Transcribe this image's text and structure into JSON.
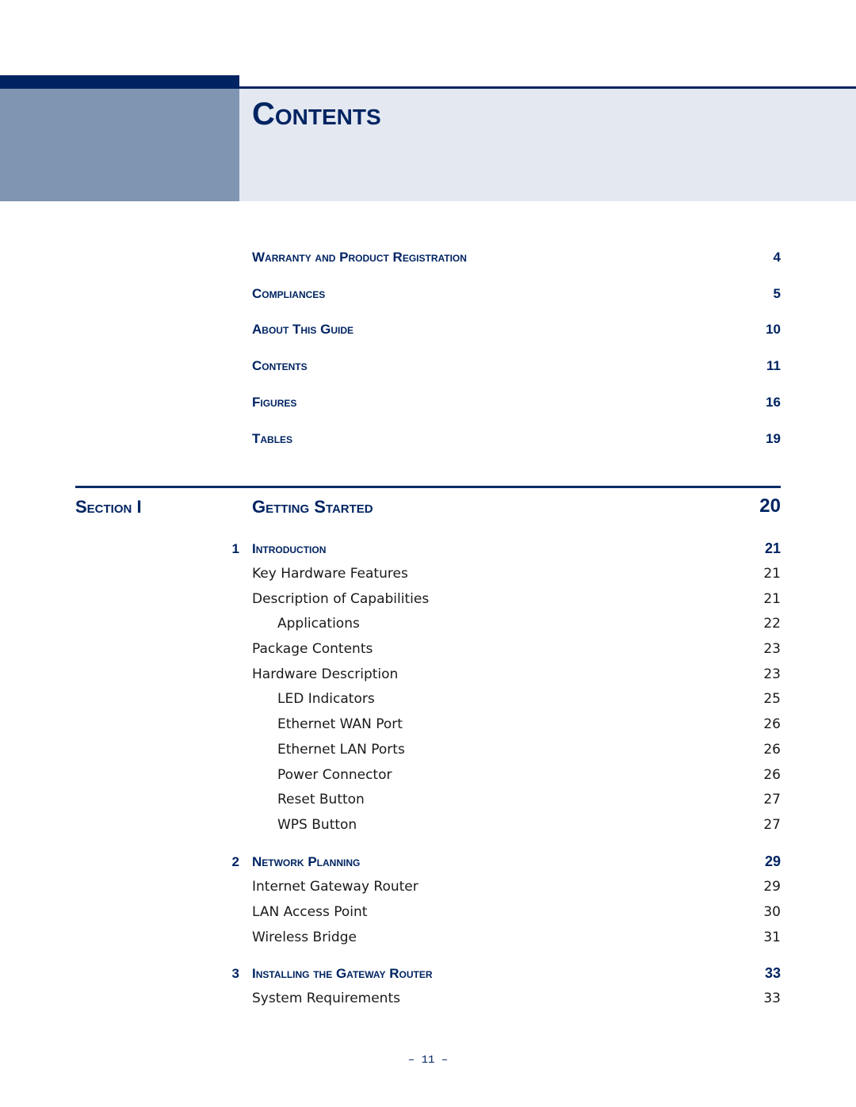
{
  "page": {
    "title": "Contents",
    "footer_page": "–  11  –",
    "colors": {
      "navy": "#002462",
      "header_left": "#8095b1",
      "header_right": "#e4e8f1",
      "body_text": "#1a1a1a"
    }
  },
  "front_matter": [
    {
      "title": "Warranty and Product Registration",
      "page": "4"
    },
    {
      "title": "Compliances",
      "page": "5"
    },
    {
      "title": "About This Guide",
      "page": "10"
    },
    {
      "title": "Contents",
      "page": "11"
    },
    {
      "title": "Figures",
      "page": "16"
    },
    {
      "title": "Tables",
      "page": "19"
    }
  ],
  "section": {
    "label": "Section I",
    "title": "Getting Started",
    "page": "20"
  },
  "chapters": [
    {
      "number": "1",
      "title": "Introduction",
      "page": "21",
      "entries": [
        {
          "label": "Key Hardware Features",
          "page": "21",
          "level": 1
        },
        {
          "label": "Description of Capabilities",
          "page": "21",
          "level": 1
        },
        {
          "label": "Applications",
          "page": "22",
          "level": 2
        },
        {
          "label": "Package Contents",
          "page": "23",
          "level": 1
        },
        {
          "label": "Hardware Description",
          "page": "23",
          "level": 1
        },
        {
          "label": "LED Indicators",
          "page": "25",
          "level": 2
        },
        {
          "label": "Ethernet WAN Port",
          "page": "26",
          "level": 2
        },
        {
          "label": "Ethernet LAN Ports",
          "page": "26",
          "level": 2
        },
        {
          "label": "Power Connector",
          "page": "26",
          "level": 2
        },
        {
          "label": "Reset Button",
          "page": "27",
          "level": 2
        },
        {
          "label": "WPS Button",
          "page": "27",
          "level": 2
        }
      ]
    },
    {
      "number": "2",
      "title": "Network Planning",
      "page": "29",
      "entries": [
        {
          "label": "Internet Gateway Router",
          "page": "29",
          "level": 1
        },
        {
          "label": "LAN Access Point",
          "page": "30",
          "level": 1
        },
        {
          "label": "Wireless Bridge",
          "page": "31",
          "level": 1
        }
      ]
    },
    {
      "number": "3",
      "title": "Installing the Gateway Router",
      "page": "33",
      "entries": [
        {
          "label": "System Requirements",
          "page": "33",
          "level": 1
        }
      ]
    }
  ]
}
